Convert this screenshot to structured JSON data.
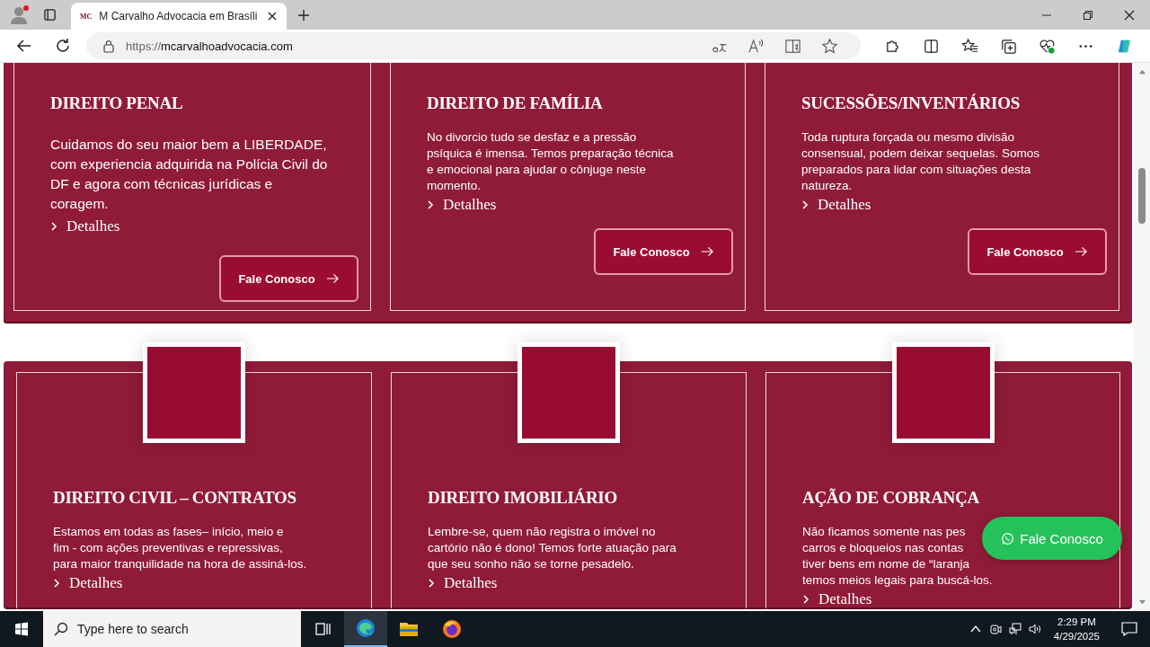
{
  "browser": {
    "favicon": "MC",
    "tab_title": "M Carvalho Advocacia em Brasíli",
    "url_scheme": "https://",
    "url_host": "mcarvalhoadvocacia.com"
  },
  "services_top": [
    {
      "title": "DIREITO PENAL",
      "body": [
        "Cuidamos do seu maior bem a LIBERDADE,",
        "com experiencia adquirida na Polícia Civil do",
        "DF e agora com técnicas jurídicas e",
        "coragem."
      ],
      "link": "Detalhes",
      "button": "Fale Conosco"
    },
    {
      "title": "DIREITO DE FAMÍLIA",
      "body": [
        "No divorcio tudo se desfaz e a pressão",
        "psíquica é imensa. Temos preparação técnica",
        "e emocional para ajudar o cônjuge neste",
        "momento."
      ],
      "link": "Detalhes",
      "button": "Fale Conosco"
    },
    {
      "title": "SUCESSÕES/INVENTÁRIOS",
      "body": [
        "Toda ruptura forçada ou mesmo divisão",
        "consensual, podem deixar sequelas. Somos",
        "preparados para lidar com situações desta",
        "natureza."
      ],
      "link": "Detalhes",
      "button": "Fale Conosco"
    }
  ],
  "services_bottom": [
    {
      "title": "DIREITO CIVIL – CONTRATOS",
      "body": [
        "Estamos em todas as fases– início, meio e",
        "fim - com ações preventivas e repressivas,",
        "para maior tranquilidade na hora de assiná-los."
      ],
      "link": "Detalhes"
    },
    {
      "title": "DIREITO IMOBILIÁRIO",
      "body": [
        "Lembre-se, quem não registra o imóvel no",
        "cartório não é dono! Temos forte atuação para",
        "que seu sonho não se torne pesadelo."
      ],
      "link": "Detalhes"
    },
    {
      "title": "AÇÃO DE COBRANÇA",
      "body": [
        "Não ficamos somente nas pes",
        "carros e bloqueios nas contas",
        "tiver bens em nome de “laranja",
        "temos meios legais para buscá-los."
      ],
      "link": "Detalhes"
    }
  ],
  "whatsapp_button": "Fale Conosco",
  "taskbar": {
    "search_placeholder": "Type here to search",
    "time": "2:29 PM",
    "date": "4/29/2025"
  }
}
